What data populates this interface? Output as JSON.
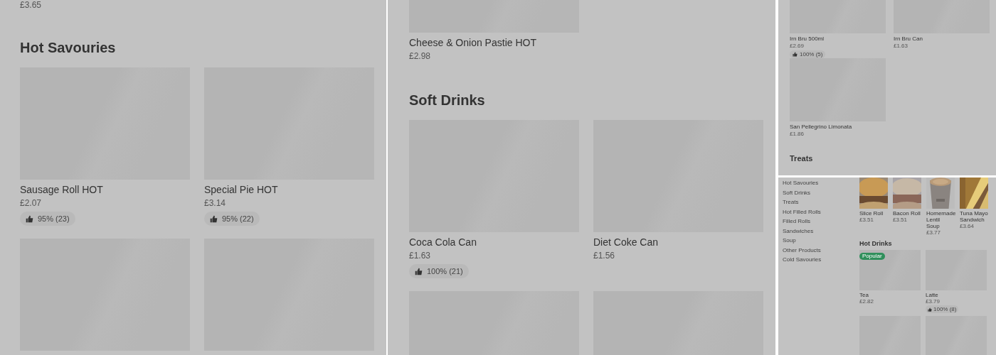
{
  "panels": [
    {
      "blocks": [
        {
          "kind": "price_tail",
          "price": "£3.65"
        },
        {
          "kind": "heading",
          "text": "Hot Savouries"
        },
        {
          "kind": "grid",
          "clipped": false,
          "items": [
            {
              "kind": "item",
              "name": "Sausage Roll HOT",
              "price": "£2.07",
              "rating": "95% (23)"
            },
            {
              "kind": "item",
              "name": "Special Pie HOT",
              "price": "£3.14",
              "rating": "95% (22)"
            },
            {
              "kind": "tile"
            },
            {
              "kind": "tile"
            }
          ]
        }
      ]
    },
    {
      "blocks": [
        {
          "kind": "grid",
          "clipped": true,
          "items": [
            {
              "kind": "item",
              "name": "Cheese & Onion Pastie HOT",
              "price": "£2.98"
            }
          ]
        },
        {
          "kind": "heading",
          "text": "Soft Drinks"
        },
        {
          "kind": "grid",
          "clipped": false,
          "items": [
            {
              "kind": "item",
              "name": "Coca Cola Can",
              "price": "£1.63",
              "rating": "100% (21)"
            },
            {
              "kind": "item",
              "name": "Diet Coke Can",
              "price": "£1.56"
            },
            {
              "kind": "tile"
            },
            {
              "kind": "tile"
            }
          ]
        }
      ]
    },
    {
      "blocks": [
        {
          "kind": "grid",
          "clipped": true,
          "items": [
            {
              "kind": "item",
              "name": "Irn Bru 500ml",
              "price": "£2.69",
              "rating": "100% (5)"
            },
            {
              "kind": "item",
              "name": "Irn Bru Can",
              "price": "£1.63"
            }
          ]
        },
        {
          "kind": "grid",
          "clipped": false,
          "items": [
            {
              "kind": "item",
              "name": "San Pellegrino Limonata",
              "price": "£1.86"
            }
          ]
        },
        {
          "kind": "heading",
          "text": "Treats"
        }
      ]
    },
    {
      "categories": [
        {
          "label": "Hot Savouries"
        },
        {
          "label": "Soft Drinks"
        },
        {
          "label": "Treats"
        },
        {
          "label": "Hot Filled Rolls"
        },
        {
          "label": "Filled Rolls"
        },
        {
          "label": "Sandwiches"
        },
        {
          "label": "Soup"
        },
        {
          "label": "Other Products"
        },
        {
          "label": "Cold Savouries"
        }
      ],
      "blocks": [
        {
          "kind": "photos",
          "items": [
            {
              "name": "Slice Roll",
              "price": "£3.51"
            },
            {
              "name": "Bacon Roll",
              "price": "£3.51"
            },
            {
              "name": "Homemade Lentil Soup",
              "price": "£3.77"
            },
            {
              "name": "Tuna Mayo Sandwich",
              "price": "£3.64"
            }
          ]
        },
        {
          "kind": "heading",
          "text": "Hot Drinks"
        },
        {
          "kind": "grid",
          "clipped": false,
          "items": [
            {
              "kind": "item",
              "name": "Tea",
              "price": "£2.82",
              "badge": "Popular"
            },
            {
              "kind": "item",
              "name": "Latte",
              "price": "£3.79",
              "rating": "100% (8)"
            },
            {
              "kind": "tile"
            },
            {
              "kind": "tile"
            }
          ]
        }
      ]
    }
  ]
}
